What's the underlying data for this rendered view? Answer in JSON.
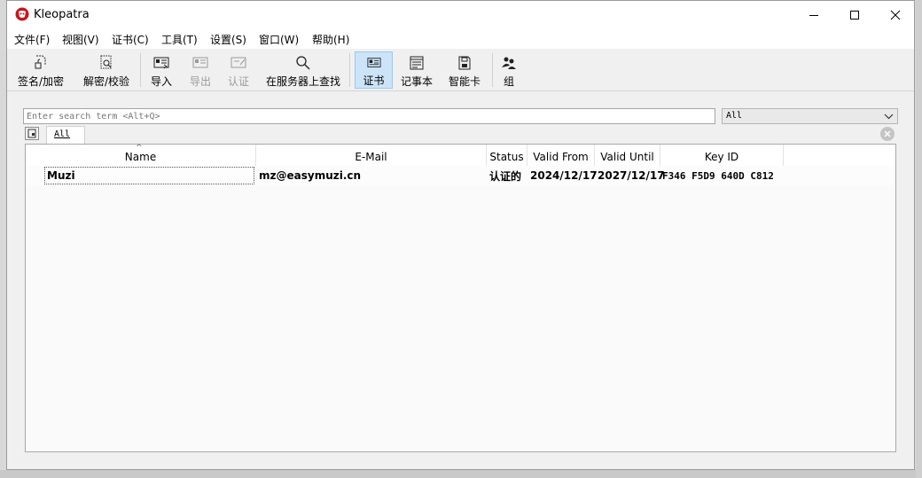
{
  "window": {
    "title": "Kleopatra"
  },
  "menu": [
    "文件(F)",
    "视图(V)",
    "证书(C)",
    "工具(T)",
    "设置(S)",
    "窗口(W)",
    "帮助(H)"
  ],
  "toolbar": {
    "sign_encrypt": "签名/加密",
    "decrypt_verify": "解密/校验",
    "import": "导入",
    "export": "导出",
    "certify": "认证",
    "lookup_server": "在服务器上查找",
    "certificates": "证书",
    "notepad": "记事本",
    "smartcards": "智能卡",
    "groups": "组"
  },
  "search": {
    "placeholder": "Enter search term <Alt+Q>",
    "value": ""
  },
  "filter": {
    "selected": "All"
  },
  "tabs": [
    {
      "label": "All"
    }
  ],
  "table": {
    "columns": [
      "Name",
      "E-Mail",
      "Status",
      "Valid From",
      "Valid Until",
      "Key ID"
    ],
    "rows": [
      {
        "name": "Muzi",
        "email": "mz@easymuzi.cn",
        "status": "认证的",
        "valid_from": "2024/12/17",
        "valid_until": "2027/12/17",
        "key_id": "F346 F5D9 640D C812"
      }
    ]
  }
}
